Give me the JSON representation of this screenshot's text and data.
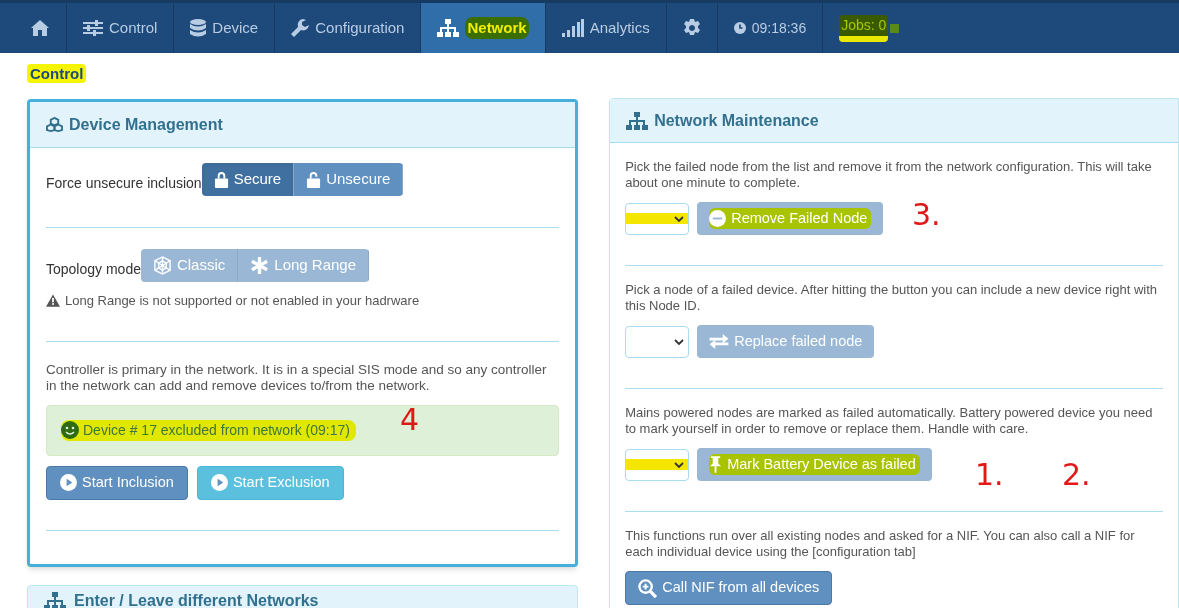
{
  "nav": {
    "items": [
      {
        "kind": "icon",
        "selected": false,
        "highlighted": false
      },
      {
        "kind": "tab",
        "label": "Control",
        "selected": false,
        "highlighted": false
      },
      {
        "kind": "tab",
        "label": "Device",
        "selected": false,
        "highlighted": false
      },
      {
        "kind": "tab",
        "label": "Configuration",
        "selected": false,
        "highlighted": false
      },
      {
        "kind": "tab",
        "label": "Network",
        "selected": true,
        "highlighted": true
      },
      {
        "kind": "tab",
        "label": "Analytics",
        "selected": false,
        "highlighted": false
      },
      {
        "kind": "icon",
        "selected": false,
        "highlighted": false
      },
      {
        "kind": "time",
        "label": "09:18:36",
        "selected": false,
        "highlighted": false
      },
      {
        "kind": "jobs",
        "label": "Jobs: 0",
        "selected": false,
        "highlighted": true
      }
    ]
  },
  "page_title": {
    "text": "Control",
    "highlighted": true
  },
  "device_management": {
    "title": "Device Management",
    "inclusion": {
      "label": "Force unsecure inclusion",
      "options": [
        {
          "label": "Secure",
          "selected": true,
          "disabled": false
        },
        {
          "label": "Unsecure",
          "selected": false,
          "disabled": false
        }
      ]
    },
    "topology": {
      "label": "Topology mode",
      "options": [
        {
          "label": "Classic",
          "selected": false,
          "disabled": true
        },
        {
          "label": "Long Range",
          "selected": false,
          "disabled": true
        }
      ],
      "warning": "Long Range is not supported or not enabled in your hadrware"
    },
    "info": "Controller is primary in the network. It is in a special SIS mode and so any controller in the network can add and remove devices to/from the network.",
    "alert": {
      "text": "Device # 17 excluded from network (09:17)",
      "highlighted": true
    },
    "buttons": [
      {
        "label": "Start Inclusion",
        "kind": "primary"
      },
      {
        "label": "Start Exclusion",
        "kind": "info"
      }
    ]
  },
  "next_panel": {
    "title": "Enter / Leave different Networks"
  },
  "network_maintenance": {
    "title": "Network Maintenance",
    "sections": [
      {
        "text": "Pick the failed node from the list and remove it from the network configuration. This will take about one minute to complete.",
        "select_highlighted": true,
        "button": {
          "label": "Remove Failed Node",
          "disabled": true,
          "highlighted": true
        }
      },
      {
        "text": "Pick a node of a failed device. After hitting the button you can include a new device right with this Node ID.",
        "select_highlighted": false,
        "button": {
          "label": "Replace failed node",
          "disabled": true,
          "highlighted": false
        }
      },
      {
        "text": "Mains powered nodes are marked as failed automatically. Battery powered device you need to mark yourself in order to remove or replace them. Handle with care.",
        "select_highlighted": true,
        "button": {
          "label": "Mark Battery Device as failed",
          "disabled": true,
          "highlighted": true
        }
      },
      {
        "text": "This functions run over all existing nodes and asked for a NIF. You can also call a NIF for each individual device using the [configuration tab]",
        "button": {
          "label": "Call NIF from all devices",
          "disabled": false,
          "highlighted": false
        }
      }
    ]
  },
  "annotations": [
    {
      "text": "4"
    },
    {
      "text": "3."
    },
    {
      "text": "1."
    },
    {
      "text": "2."
    }
  ]
}
